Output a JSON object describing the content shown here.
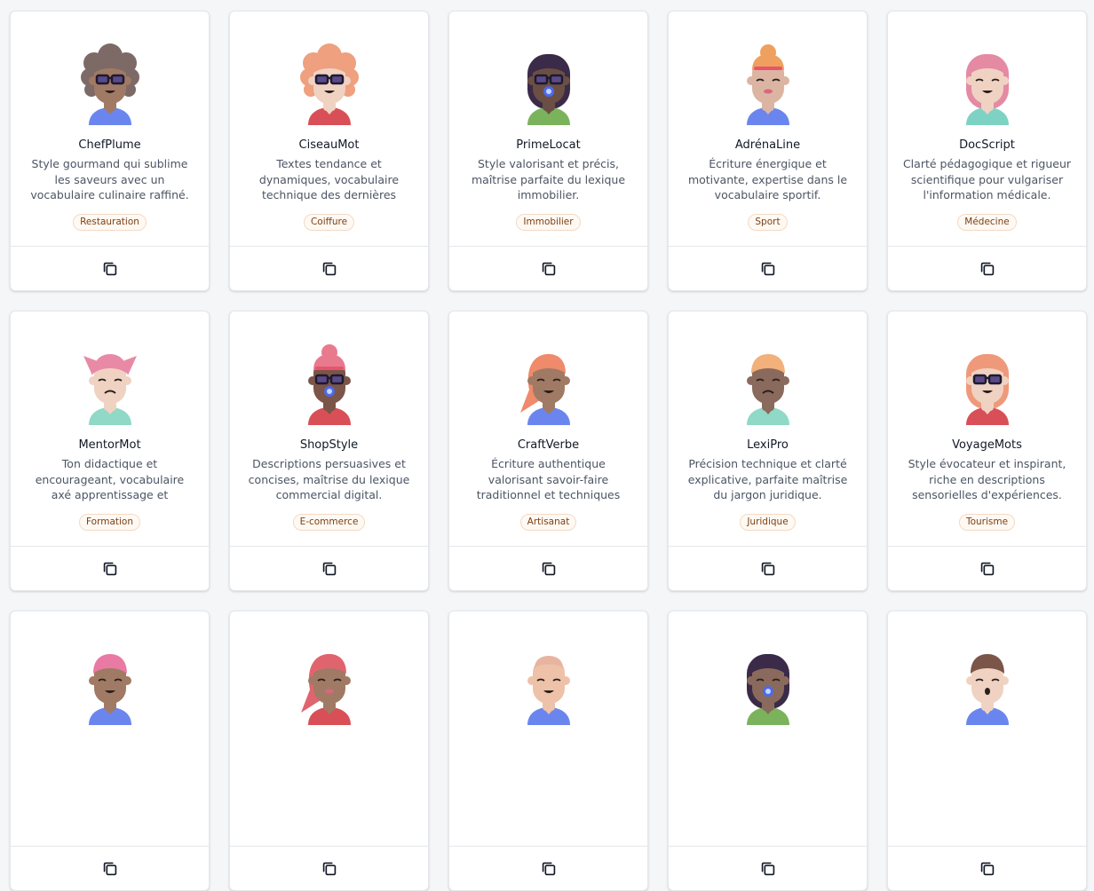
{
  "cards": [
    {
      "name": "ChefPlume",
      "desc": "Style gourmand qui sublime les saveurs avec un vocabulaire culinaire raffiné.",
      "tag": "Restauration",
      "avatar": {
        "skin": "#a07a64",
        "hair": "#7d6a66",
        "hairStyle": "curly",
        "shirt": "#6a86ee",
        "glasses": true,
        "expr": "smile",
        "pacifier": false
      }
    },
    {
      "name": "CiseauMot",
      "desc": "Textes tendance et dynamiques, vocabulaire technique des dernières coupes stylées.",
      "tag": "Coiffure",
      "avatar": {
        "skin": "#f0d2c2",
        "hair": "#eea07f",
        "hairStyle": "curly",
        "shirt": "#d94f57",
        "glasses": true,
        "expr": "smile",
        "pacifier": false
      }
    },
    {
      "name": "PrimeLocat",
      "desc": "Style valorisant et précis, maîtrise parfaite du lexique immobilier.",
      "tag": "Immobilier",
      "avatar": {
        "skin": "#6b4f44",
        "hair": "#3b2b49",
        "hairStyle": "long",
        "shirt": "#7bb35c",
        "glasses": true,
        "expr": "none",
        "pacifier": true
      }
    },
    {
      "name": "AdrénaLine",
      "desc": "Écriture énergique et motivante, expertise dans le vocabulaire sportif.",
      "tag": "Sport",
      "avatar": {
        "skin": "#dcb4a2",
        "hair": "#f0a05e",
        "hairStyle": "bun",
        "shirt": "#6a86ee",
        "glasses": false,
        "expr": "lips",
        "pacifier": false
      }
    },
    {
      "name": "DocScript",
      "desc": "Clarté pédagogique et rigueur scientifique pour vulgariser l'information médicale.",
      "tag": "Médecine",
      "avatar": {
        "skin": "#f0d2c2",
        "hair": "#e58aa3",
        "hairStyle": "long",
        "shirt": "#7ed2c4",
        "glasses": false,
        "expr": "smile",
        "pacifier": false
      }
    },
    {
      "name": "MentorMot",
      "desc": "Ton didactique et encourageant, vocabulaire axé apprentissage et progression.",
      "tag": "Formation",
      "avatar": {
        "skin": "#f0d2c2",
        "hair": "#e88aa6",
        "hairStyle": "pigtails",
        "shirt": "#8fd9c6",
        "glasses": false,
        "expr": "frown",
        "pacifier": false
      }
    },
    {
      "name": "ShopStyle",
      "desc": "Descriptions persuasives et concises, maîtrise du lexique commercial digital.",
      "tag": "E-commerce",
      "avatar": {
        "skin": "#7a5548",
        "hair": "#e87a8e",
        "hairStyle": "bun",
        "shirt": "#d94f57",
        "glasses": true,
        "expr": "none",
        "pacifier": true
      }
    },
    {
      "name": "CraftVerbe",
      "desc": "Écriture authentique valorisant savoir-faire traditionnel et techniques artisanales.",
      "tag": "Artisanat",
      "avatar": {
        "skin": "#a07a64",
        "hair": "#ef8a6a",
        "hairStyle": "side",
        "shirt": "#6a86ee",
        "glasses": false,
        "expr": "smile",
        "pacifier": false
      }
    },
    {
      "name": "LexiPro",
      "desc": "Précision technique et clarté explicative, parfaite maîtrise du jargon juridique.",
      "tag": "Juridique",
      "avatar": {
        "skin": "#8a6a5c",
        "hair": "#f2b07a",
        "hairStyle": "short",
        "shirt": "#8fd9c6",
        "glasses": false,
        "expr": "frown",
        "pacifier": false
      }
    },
    {
      "name": "VoyageMots",
      "desc": "Style évocateur et inspirant, riche en descriptions sensorielles d'expériences.",
      "tag": "Tourisme",
      "avatar": {
        "skin": "#f0d2c2",
        "hair": "#ee9a7a",
        "hairStyle": "long",
        "shirt": "#d94f57",
        "glasses": true,
        "expr": "smile",
        "pacifier": false
      }
    },
    {
      "name": "",
      "desc": "",
      "tag": "",
      "avatar": {
        "skin": "#a07a64",
        "hair": "#e87aa4",
        "hairStyle": "short",
        "shirt": "#6a86ee",
        "glasses": false,
        "expr": "smile",
        "pacifier": false
      }
    },
    {
      "name": "",
      "desc": "",
      "tag": "",
      "avatar": {
        "skin": "#a07a64",
        "hair": "#e0646e",
        "hairStyle": "side",
        "shirt": "#d94f57",
        "glasses": false,
        "expr": "lips",
        "pacifier": false
      }
    },
    {
      "name": "",
      "desc": "",
      "tag": "",
      "avatar": {
        "skin": "#eec2a8",
        "hair": "#e8b4a0",
        "hairStyle": "bald",
        "shirt": "#6a86ee",
        "glasses": false,
        "expr": "smile",
        "pacifier": false
      }
    },
    {
      "name": "",
      "desc": "",
      "tag": "",
      "avatar": {
        "skin": "#8a6a5c",
        "hair": "#3b2b49",
        "hairStyle": "long",
        "shirt": "#7bb35c",
        "glasses": false,
        "expr": "none",
        "pacifier": true
      }
    },
    {
      "name": "",
      "desc": "",
      "tag": "",
      "avatar": {
        "skin": "#f0d2c2",
        "hair": "#7a5548",
        "hairStyle": "short",
        "shirt": "#6a86ee",
        "glasses": false,
        "expr": "open",
        "pacifier": false
      }
    }
  ],
  "icons": {
    "copy": "copy-icon",
    "avatar": "avatar-icon"
  }
}
